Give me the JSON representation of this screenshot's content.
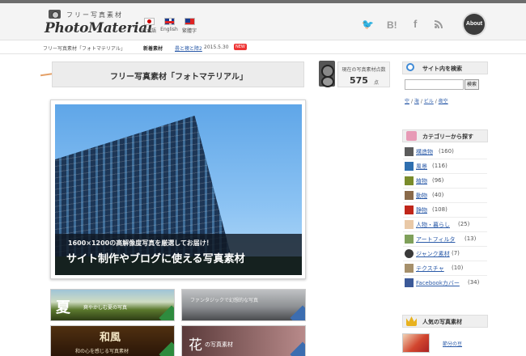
{
  "header": {
    "tagline": "フリー写真素材",
    "logo": "PhotoMaterial",
    "languages": [
      {
        "label": "日本語"
      },
      {
        "label": "English"
      },
      {
        "label": "繁體字"
      }
    ],
    "social": {
      "twitter": "🐦",
      "hatena": "B!",
      "facebook": "f"
    },
    "about_label": "About"
  },
  "crumbbar": {
    "breadcrumb": "フリー写真素材「フォトマテリアル」",
    "news_label": "新着素材",
    "news_link": "畳と襖と障2",
    "news_date": "2015.5.30",
    "news_badge": "NEW"
  },
  "main": {
    "title": "フリー写真素材「フォトマテリアル」",
    "counter": {
      "label": "現在の写真素材点数",
      "value": "575",
      "unit": "点"
    },
    "hero": {
      "subtitle": "1600×1200の高解像度写真を厳選してお届け！",
      "title": "サイト制作やブログに使える写真素材"
    },
    "banners": [
      {
        "title": "夏",
        "subtitle": "爽やかしむ夏の写真"
      },
      {
        "title": "ファンタジックで幻想的な写真",
        "subtitle": ""
      },
      {
        "title": "和風",
        "subtitle": "和の心を感じる写真素材"
      },
      {
        "title": "花",
        "subtitle": "の写真素材"
      }
    ]
  },
  "sidebar": {
    "search": {
      "heading": "サイト内を検索",
      "value": "",
      "button": "検索",
      "tags": [
        "空",
        "/",
        "海",
        "/",
        "ビル",
        "/",
        "夜空"
      ]
    },
    "categories": {
      "heading": "カテゴリーから探す",
      "items": [
        {
          "name": "構造物",
          "count": "(160)",
          "color": "#5b5b5b"
        },
        {
          "name": "風景",
          "count": "(116)",
          "color": "#2f6fb0"
        },
        {
          "name": "植物",
          "count": "(96)",
          "color": "#7a8c2b"
        },
        {
          "name": "動物",
          "count": "(40)",
          "color": "#8a6a4a"
        },
        {
          "name": "静物",
          "count": "(108)",
          "color": "#c0261a"
        },
        {
          "name": "人物・暮らし",
          "count": "(25)",
          "color": "#e9c9a7"
        },
        {
          "name": "アートフィルタ",
          "count": "(13)",
          "color": "#7fa05a"
        },
        {
          "name": "ジャンク素材",
          "count": "(7)",
          "color": "#3a3a3a"
        },
        {
          "name": "テクスチャ",
          "count": "(10)",
          "color": "#a6906b"
        },
        {
          "name": "Facebookカバー",
          "count": "(34)",
          "color": "#3b5998"
        }
      ]
    },
    "popular": {
      "heading": "人気の写真素材",
      "item": "節分の豆"
    }
  }
}
